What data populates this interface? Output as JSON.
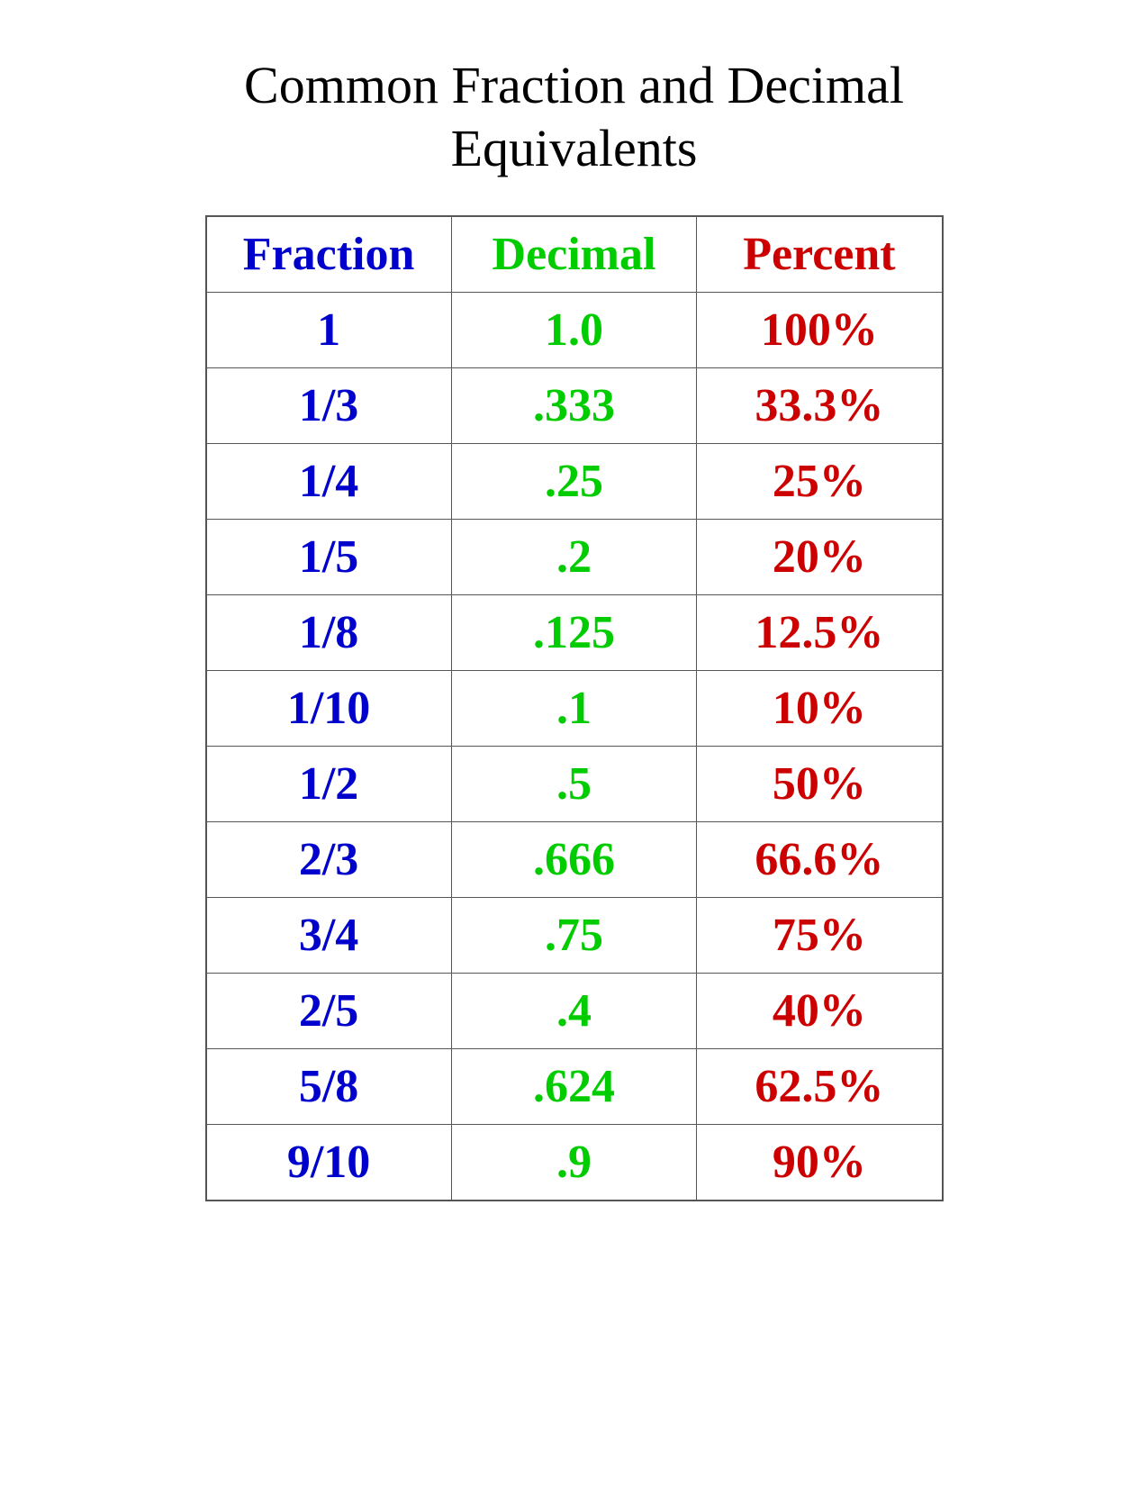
{
  "title": "Common Fraction and Decimal Equivalents",
  "table": {
    "headers": {
      "fraction": "Fraction",
      "decimal": "Decimal",
      "percent": "Percent"
    },
    "rows": [
      {
        "fraction": "1",
        "decimal": "1.0",
        "percent": "100%"
      },
      {
        "fraction": "1/3",
        "decimal": ".333",
        "percent": "33.3%"
      },
      {
        "fraction": "1/4",
        "decimal": ".25",
        "percent": "25%"
      },
      {
        "fraction": "1/5",
        "decimal": ".2",
        "percent": "20%"
      },
      {
        "fraction": "1/8",
        "decimal": ".125",
        "percent": "12.5%"
      },
      {
        "fraction": "1/10",
        "decimal": ".1",
        "percent": "10%"
      },
      {
        "fraction": "1/2",
        "decimal": ".5",
        "percent": "50%"
      },
      {
        "fraction": "2/3",
        "decimal": ".666",
        "percent": "66.6%"
      },
      {
        "fraction": "3/4",
        "decimal": ".75",
        "percent": "75%"
      },
      {
        "fraction": "2/5",
        "decimal": ".4",
        "percent": "40%"
      },
      {
        "fraction": "5/8",
        "decimal": ".624",
        "percent": "62.5%"
      },
      {
        "fraction": "9/10",
        "decimal": ".9",
        "percent": "90%"
      }
    ]
  }
}
